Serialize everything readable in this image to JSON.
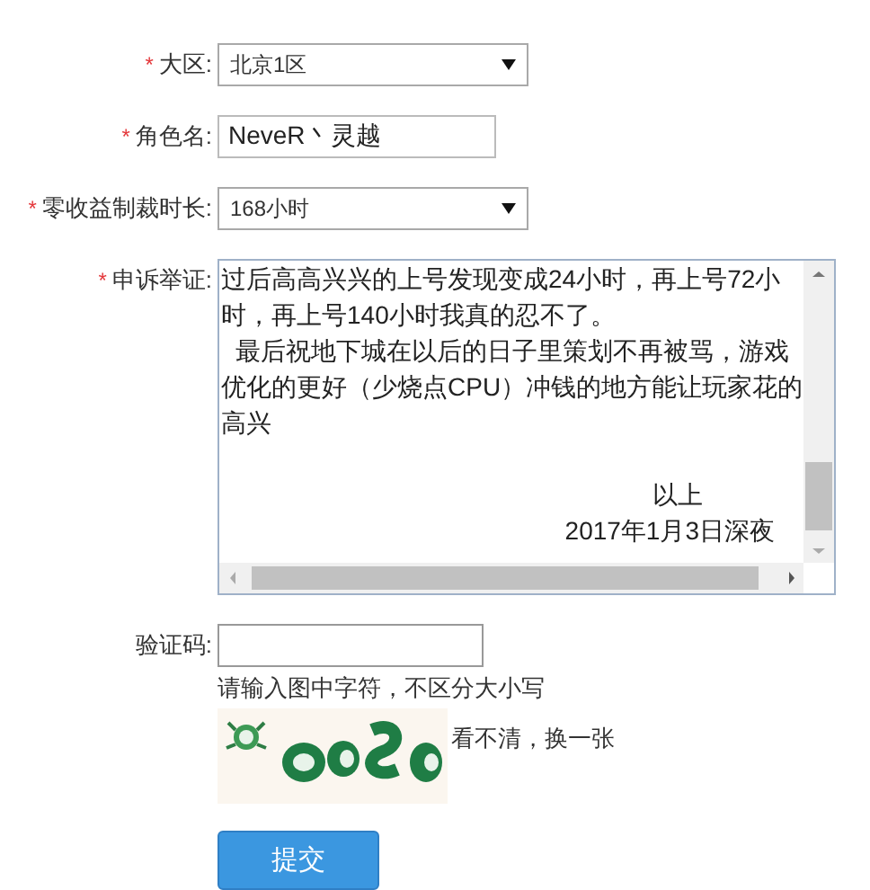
{
  "fields": [
    {
      "kind": "select",
      "required_mark": "*",
      "label": "大区:",
      "value": "北京1区"
    },
    {
      "kind": "text",
      "required_mark": "*",
      "label": "角色名:",
      "value": "NeveR丶灵越"
    },
    {
      "kind": "select",
      "required_mark": "*",
      "label": "零收益制裁时长:",
      "value": "168小时"
    },
    {
      "kind": "textarea",
      "required_mark": "*",
      "label": "申诉举证:",
      "lines": [
        "过后高高兴兴的上号发现变成24小时，再上号72小",
        "时，再上号140小时我真的忍不了。",
        "  最后祝地下城在以后的日子里策划不再被骂，游戏",
        "优化的更好（少烧点CPU）冲钱的地方能让玩家花的",
        "高兴"
      ],
      "signature": [
        "以上",
        "2017年1月3日深夜"
      ]
    },
    {
      "kind": "captcha",
      "label": "验证码:",
      "hint": "请输入图中字符，不区分大小写",
      "refresh_link": "看不清，换一张"
    }
  ],
  "submit": "提交"
}
